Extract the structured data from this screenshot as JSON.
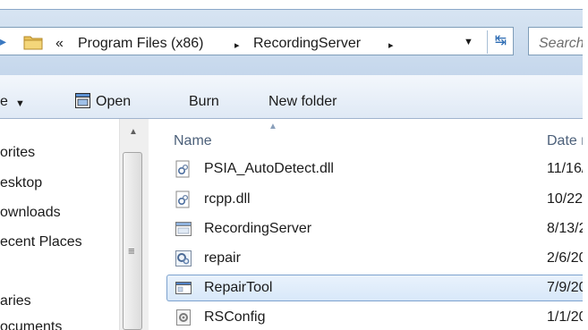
{
  "address_bar": {
    "overflow_chevron": "«",
    "breadcrumbs": [
      "Program Files (x86)",
      "RecordingServer"
    ],
    "separator": "▸",
    "search_placeholder": "Search"
  },
  "toolbar": {
    "organize_label": "e",
    "open_label": "Open",
    "burn_label": "Burn",
    "new_folder_label": "New folder"
  },
  "nav_pane": {
    "items": [
      "orites",
      "esktop",
      "ownloads",
      "ecent Places",
      "aries",
      "ocuments"
    ]
  },
  "file_list": {
    "columns": {
      "name": "Name",
      "date": "Date m"
    },
    "rows": [
      {
        "name": "PSIA_AutoDetect.dll",
        "date": "11/16/",
        "icon": "dll-icon",
        "selected": false
      },
      {
        "name": "rcpp.dll",
        "date": "10/22/",
        "icon": "dll-icon",
        "selected": false
      },
      {
        "name": "RecordingServer",
        "date": "8/13/2",
        "icon": "application-icon",
        "selected": false
      },
      {
        "name": "repair",
        "date": "2/6/20",
        "icon": "settings-file-icon",
        "selected": false
      },
      {
        "name": "RepairTool",
        "date": "7/9/20",
        "icon": "window-app-icon",
        "selected": true
      },
      {
        "name": "RSConfig",
        "date": "1/1/20",
        "icon": "config-file-icon",
        "selected": false
      }
    ]
  },
  "colors": {
    "selection_fill": "#d8e8f9",
    "selection_border": "#7da2ce",
    "header_text": "#4c607a"
  }
}
